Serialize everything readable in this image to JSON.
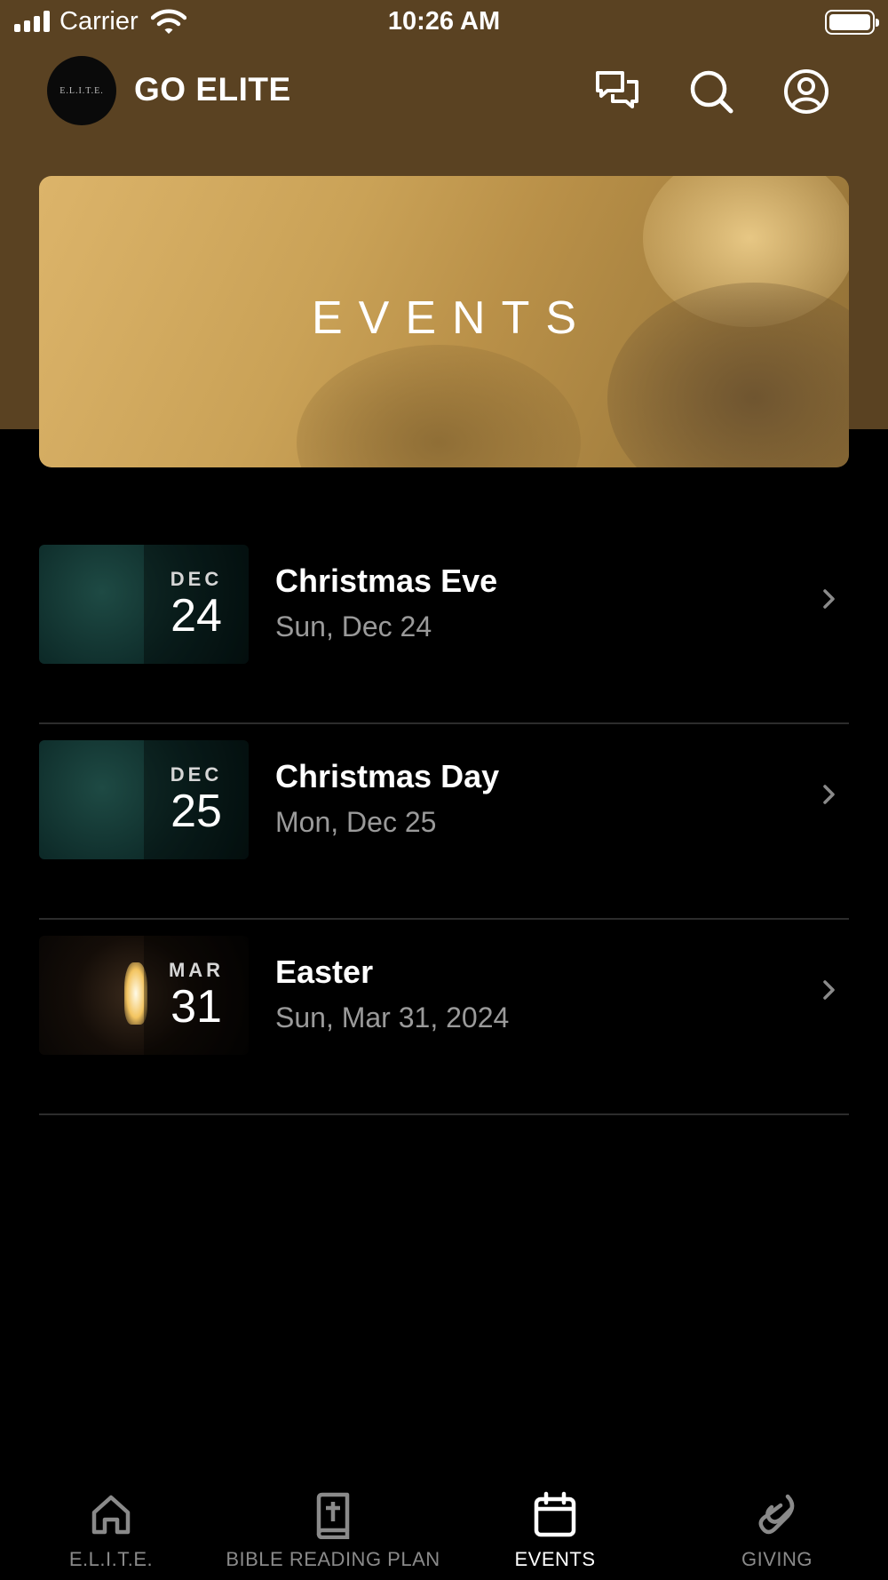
{
  "status_bar": {
    "carrier": "Carrier",
    "time": "10:26 AM"
  },
  "header": {
    "logo_text": "E.L.I.T.E.",
    "title": "GO ELITE",
    "icons": [
      "chat-icon",
      "search-icon",
      "profile-icon"
    ]
  },
  "banner": {
    "title": "EVENTS"
  },
  "events": [
    {
      "month": "DEC",
      "day": "24",
      "title": "Christmas Eve",
      "date": "Sun, Dec 24",
      "thumb": "pine"
    },
    {
      "month": "DEC",
      "day": "25",
      "title": "Christmas Day",
      "date": "Mon, Dec 25",
      "thumb": "pine"
    },
    {
      "month": "MAR",
      "day": "31",
      "title": "Easter",
      "date": "Sun, Mar 31, 2024",
      "thumb": "cave"
    }
  ],
  "tabs": [
    {
      "label": "E.L.I.T.E.",
      "icon": "home-icon",
      "active": false
    },
    {
      "label": "BIBLE READING PLAN",
      "icon": "bible-icon",
      "active": false
    },
    {
      "label": "EVENTS",
      "icon": "calendar-icon",
      "active": true
    },
    {
      "label": "GIVING",
      "icon": "giving-icon",
      "active": false
    }
  ],
  "colors": {
    "header_bg": "#5a4222",
    "background": "#000000",
    "tab_active": "#ffffff",
    "tab_inactive": "#8a8a8a"
  }
}
